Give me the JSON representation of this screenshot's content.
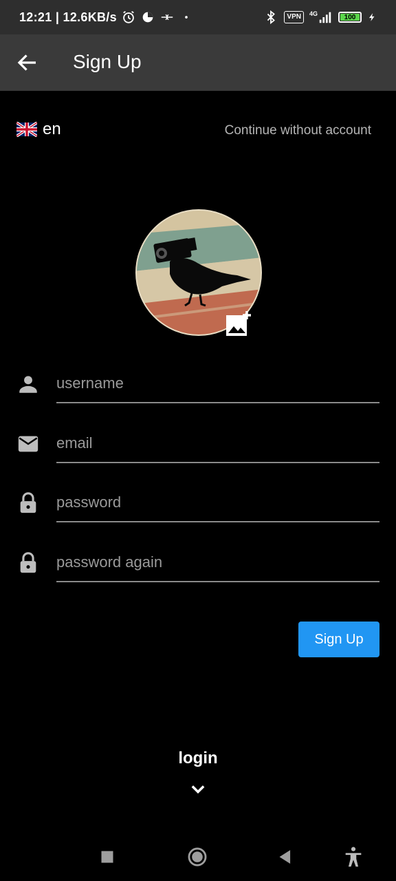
{
  "status_bar": {
    "time_speed": "12:21 | 12.6KB/s",
    "vpn": "VPN",
    "network": "4G",
    "battery": "100"
  },
  "app_bar": {
    "title": "Sign Up"
  },
  "language": {
    "code": "en"
  },
  "continue_without_account": "Continue without account",
  "form": {
    "username_placeholder": "username",
    "email_placeholder": "email",
    "password_placeholder": "password",
    "password_again_placeholder": "password again",
    "submit_label": "Sign Up"
  },
  "login_label": "login",
  "colors": {
    "accent": "#2196f3",
    "background": "#000000",
    "app_bar": "#3a3a3a",
    "status_bar": "#2e2e2e"
  },
  "icons": {
    "back": "arrow-back-icon",
    "username": "person-icon",
    "email": "mail-icon",
    "password": "lock-icon",
    "add_photo": "add-photo-icon",
    "expand": "chevron-down-icon"
  }
}
